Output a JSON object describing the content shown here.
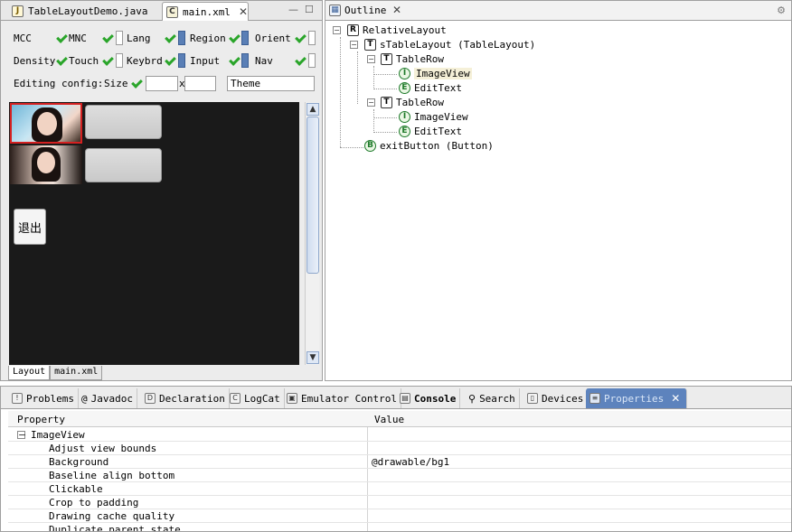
{
  "editor": {
    "tabs": [
      {
        "label": "TableLayoutDemo.java",
        "icon": "java-file-icon"
      },
      {
        "label": "main.xml",
        "icon": "xml-file-icon"
      }
    ],
    "config_row1": [
      "MCC",
      "MNC",
      "Lang",
      "Region",
      "Orient"
    ],
    "config_row2": [
      "Density",
      "Touch",
      "Keybrd",
      "Input",
      "Nav"
    ],
    "editing_label": "Editing config:",
    "size_label": "Size",
    "size_x": "x",
    "theme_value": "Theme",
    "exit_button_label": "退出",
    "bottom_tabs": [
      "Layout",
      "main.xml"
    ]
  },
  "outline": {
    "title": "Outline",
    "nodes": [
      {
        "icon": "R",
        "label": "RelativeLayout"
      },
      {
        "icon": "T",
        "label": "sTableLayout (TableLayout)"
      },
      {
        "icon": "T",
        "label": "TableRow"
      },
      {
        "icon": "I",
        "label": "ImageView"
      },
      {
        "icon": "E",
        "label": "EditText"
      },
      {
        "icon": "T",
        "label": "TableRow"
      },
      {
        "icon": "I",
        "label": "ImageView"
      },
      {
        "icon": "E",
        "label": "EditText"
      },
      {
        "icon": "B",
        "label": "exitButton (Button)"
      }
    ]
  },
  "views": {
    "tabs": [
      "Problems",
      "Javadoc",
      "Declaration",
      "LogCat",
      "Emulator Control",
      "Console",
      "Search",
      "Devices",
      "Properties"
    ],
    "properties": {
      "col_property": "Property",
      "col_value": "Value",
      "group": "ImageView",
      "rows": [
        {
          "name": "Adjust view bounds",
          "value": ""
        },
        {
          "name": "Background",
          "value": "@drawable/bg1"
        },
        {
          "name": "Baseline align bottom",
          "value": ""
        },
        {
          "name": "Clickable",
          "value": ""
        },
        {
          "name": "Crop to padding",
          "value": ""
        },
        {
          "name": "Drawing cache quality",
          "value": ""
        },
        {
          "name": "Duplicate parent state",
          "value": ""
        }
      ]
    }
  }
}
